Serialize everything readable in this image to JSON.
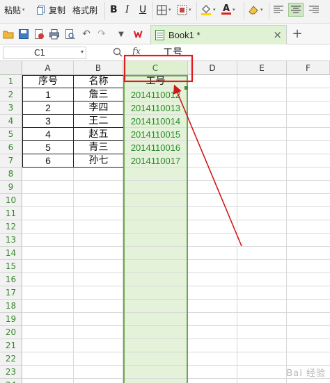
{
  "ribbon": {
    "paste_label": "粘贴",
    "copy_label": "复制",
    "format_painter_label": "格式刷",
    "bold": "B",
    "italic": "I",
    "underline": "U",
    "font_color_glyph": "A",
    "highlight_color": "#ffd400",
    "font_color": "#e02020"
  },
  "tabs": {
    "doc_title": "Book1 *",
    "new_tab": "+",
    "close": "×"
  },
  "formula_bar": {
    "cell_reference": "C1",
    "fx_label": "fx",
    "content": "工号"
  },
  "sheet": {
    "columns": [
      "A",
      "B",
      "C",
      "D",
      "E",
      "F"
    ],
    "selected_column": "C",
    "rows": [
      "1",
      "2",
      "3",
      "4",
      "5",
      "6",
      "7",
      "8",
      "9",
      "10",
      "11",
      "12",
      "13",
      "14",
      "15",
      "16",
      "17",
      "18",
      "19",
      "20",
      "21",
      "22",
      "23",
      "24"
    ],
    "header_row": {
      "a": "序号",
      "b": "名称",
      "c": "工号"
    },
    "data_rows": [
      {
        "a": "1",
        "b": "詹三",
        "c": "2014110012"
      },
      {
        "a": "2",
        "b": "李四",
        "c": "2014110013"
      },
      {
        "a": "3",
        "b": "王二",
        "c": "2014110014"
      },
      {
        "a": "4",
        "b": "赵五",
        "c": "2014110015"
      },
      {
        "a": "5",
        "b": "青三",
        "c": "2014110016"
      },
      {
        "a": "6",
        "b": "孙七",
        "c": "2014110017"
      }
    ]
  },
  "annotation": {
    "highlight_color": "#e01b1b",
    "arrow_color": "#d01818"
  },
  "watermark": "Bai 经验"
}
